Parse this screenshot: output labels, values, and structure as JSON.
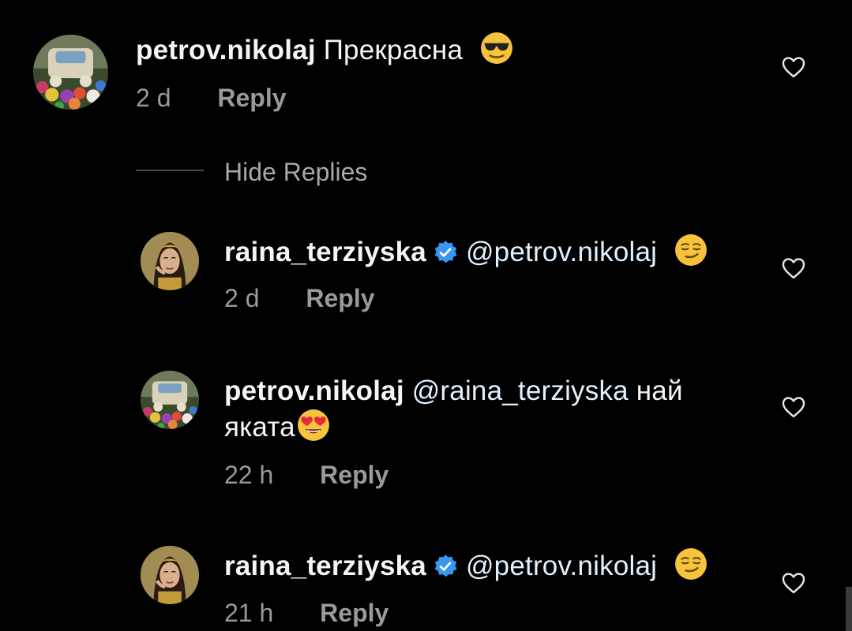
{
  "comments": [
    {
      "username": "petrov.nikolaj",
      "mention": "",
      "text": "Прекрасна",
      "emoji_icon": "smiling-face-with-sunglasses-icon",
      "time": "2 d",
      "reply_label": "Reply"
    }
  ],
  "replies_toggle": {
    "label": "Hide Replies"
  },
  "replies": [
    {
      "username": "raina_terziyska",
      "verified": true,
      "mention": "@petrov.nikolaj",
      "text": "",
      "emoji_icon": "smirking-face-icon",
      "time": "2 d",
      "reply_label": "Reply"
    },
    {
      "username": "petrov.nikolaj",
      "verified": false,
      "mention": "@raina_terziyska",
      "text_line1": "най",
      "text_line2": "яката",
      "emoji_icon": "smiling-face-with-heart-eyes-icon",
      "time": "22 h",
      "reply_label": "Reply"
    },
    {
      "username": "raina_terziyska",
      "verified": true,
      "mention": "@petrov.nikolaj",
      "text": "",
      "emoji_icon": "smirking-face-icon",
      "time": "21 h",
      "reply_label": "Reply"
    }
  ],
  "colors": {
    "background": "#000000",
    "text": "#f5f5f5",
    "secondary": "#9a9a9a",
    "verified": "#3897f0",
    "emoji": "#f7c33b"
  }
}
